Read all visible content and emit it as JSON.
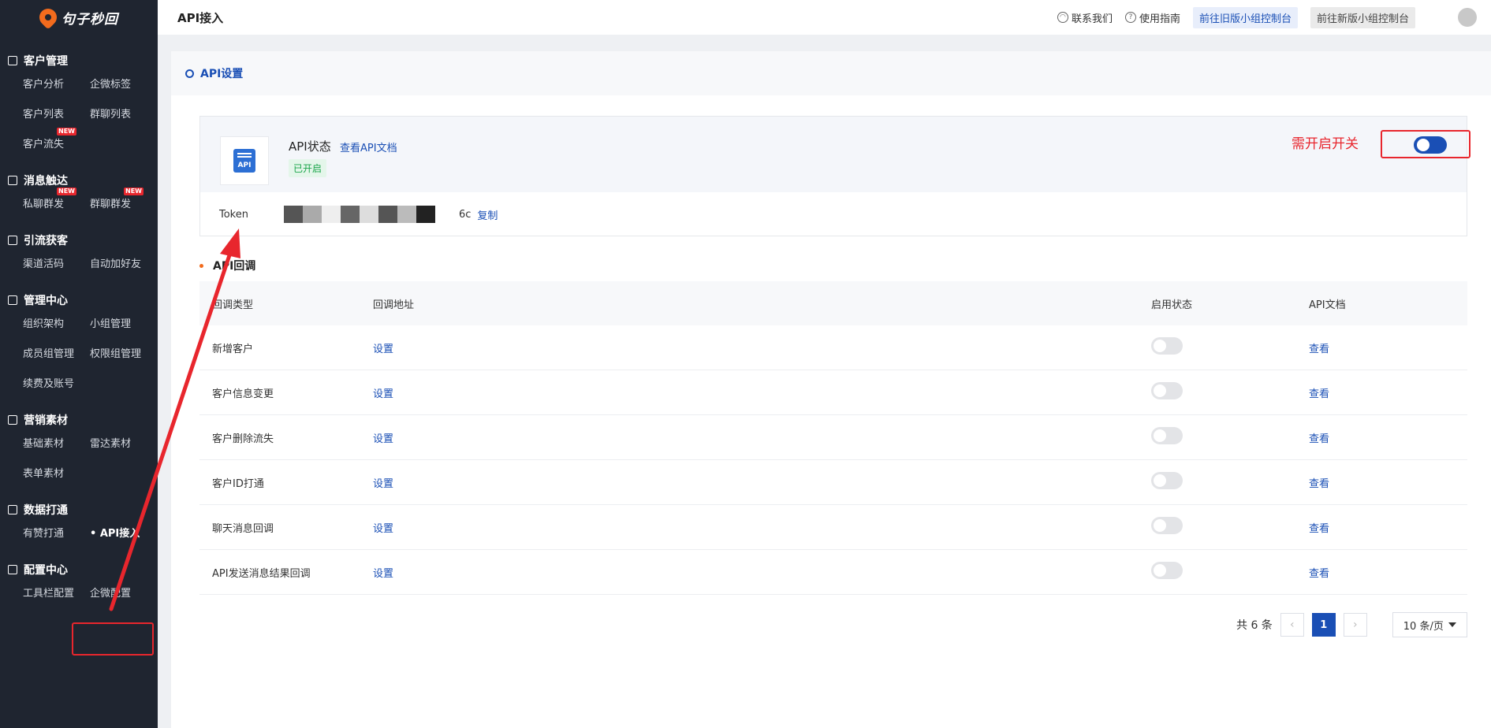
{
  "app": {
    "logo_text": "句子秒回"
  },
  "sidebar": {
    "groups": [
      {
        "title": "客户管理",
        "items": [
          {
            "label": "客户分析"
          },
          {
            "label": "企微标签"
          },
          {
            "label": "客户列表"
          },
          {
            "label": "群聊列表"
          },
          {
            "label": "客户流失",
            "badge": "NEW"
          }
        ]
      },
      {
        "title": "消息触达",
        "items": [
          {
            "label": "私聊群发",
            "badge": "NEW"
          },
          {
            "label": "群聊群发",
            "badge": "NEW"
          }
        ]
      },
      {
        "title": "引流获客",
        "items": [
          {
            "label": "渠道活码"
          },
          {
            "label": "自动加好友"
          }
        ]
      },
      {
        "title": "管理中心",
        "items": [
          {
            "label": "组织架构"
          },
          {
            "label": "小组管理"
          },
          {
            "label": "成员组管理"
          },
          {
            "label": "权限组管理"
          },
          {
            "label": "续费及账号"
          }
        ]
      },
      {
        "title": "营销素材",
        "items": [
          {
            "label": "基础素材"
          },
          {
            "label": "雷达素材"
          },
          {
            "label": "表单素材"
          }
        ]
      },
      {
        "title": "数据打通",
        "items": [
          {
            "label": "有赞打通"
          },
          {
            "label": "• API接入",
            "active": true
          }
        ]
      },
      {
        "title": "配置中心",
        "items": [
          {
            "label": "工具栏配置"
          },
          {
            "label": "企微配置"
          }
        ]
      }
    ]
  },
  "topbar": {
    "title": "API接入",
    "contact": "联系我们",
    "guide": "使用指南",
    "old_console": "前往旧版小组控制台",
    "new_console": "前往新版小组控制台"
  },
  "api_settings": {
    "section_title": "API设置",
    "icon_text": "API",
    "status_label": "API状态",
    "doc_link": "查看API文档",
    "status_tag": "已开启",
    "hint": "需开启开关",
    "switch_on": true,
    "token_label": "Token",
    "token_tail": "6c",
    "copy": "复制"
  },
  "callback": {
    "title": "API回调",
    "headers": [
      "回调类型",
      "回调地址",
      "启用状态",
      "API文档"
    ],
    "rows": [
      {
        "type": "新增客户",
        "action": "设置",
        "enabled": false,
        "doc": "查看"
      },
      {
        "type": "客户信息变更",
        "action": "设置",
        "enabled": false,
        "doc": "查看"
      },
      {
        "type": "客户删除流失",
        "action": "设置",
        "enabled": false,
        "doc": "查看"
      },
      {
        "type": "客户ID打通",
        "action": "设置",
        "enabled": false,
        "doc": "查看"
      },
      {
        "type": "聊天消息回调",
        "action": "设置",
        "enabled": false,
        "doc": "查看"
      },
      {
        "type": "API发送消息结果回调",
        "action": "设置",
        "enabled": false,
        "doc": "查看"
      }
    ]
  },
  "pagination": {
    "total": "共 6 条",
    "current_page": "1",
    "page_size": "10 条/页"
  },
  "colors": {
    "sidebar_bg": "#1f2530",
    "primary": "#1a4fb5",
    "annotation": "#e8262d",
    "brand_orange": "#f26b1d"
  }
}
